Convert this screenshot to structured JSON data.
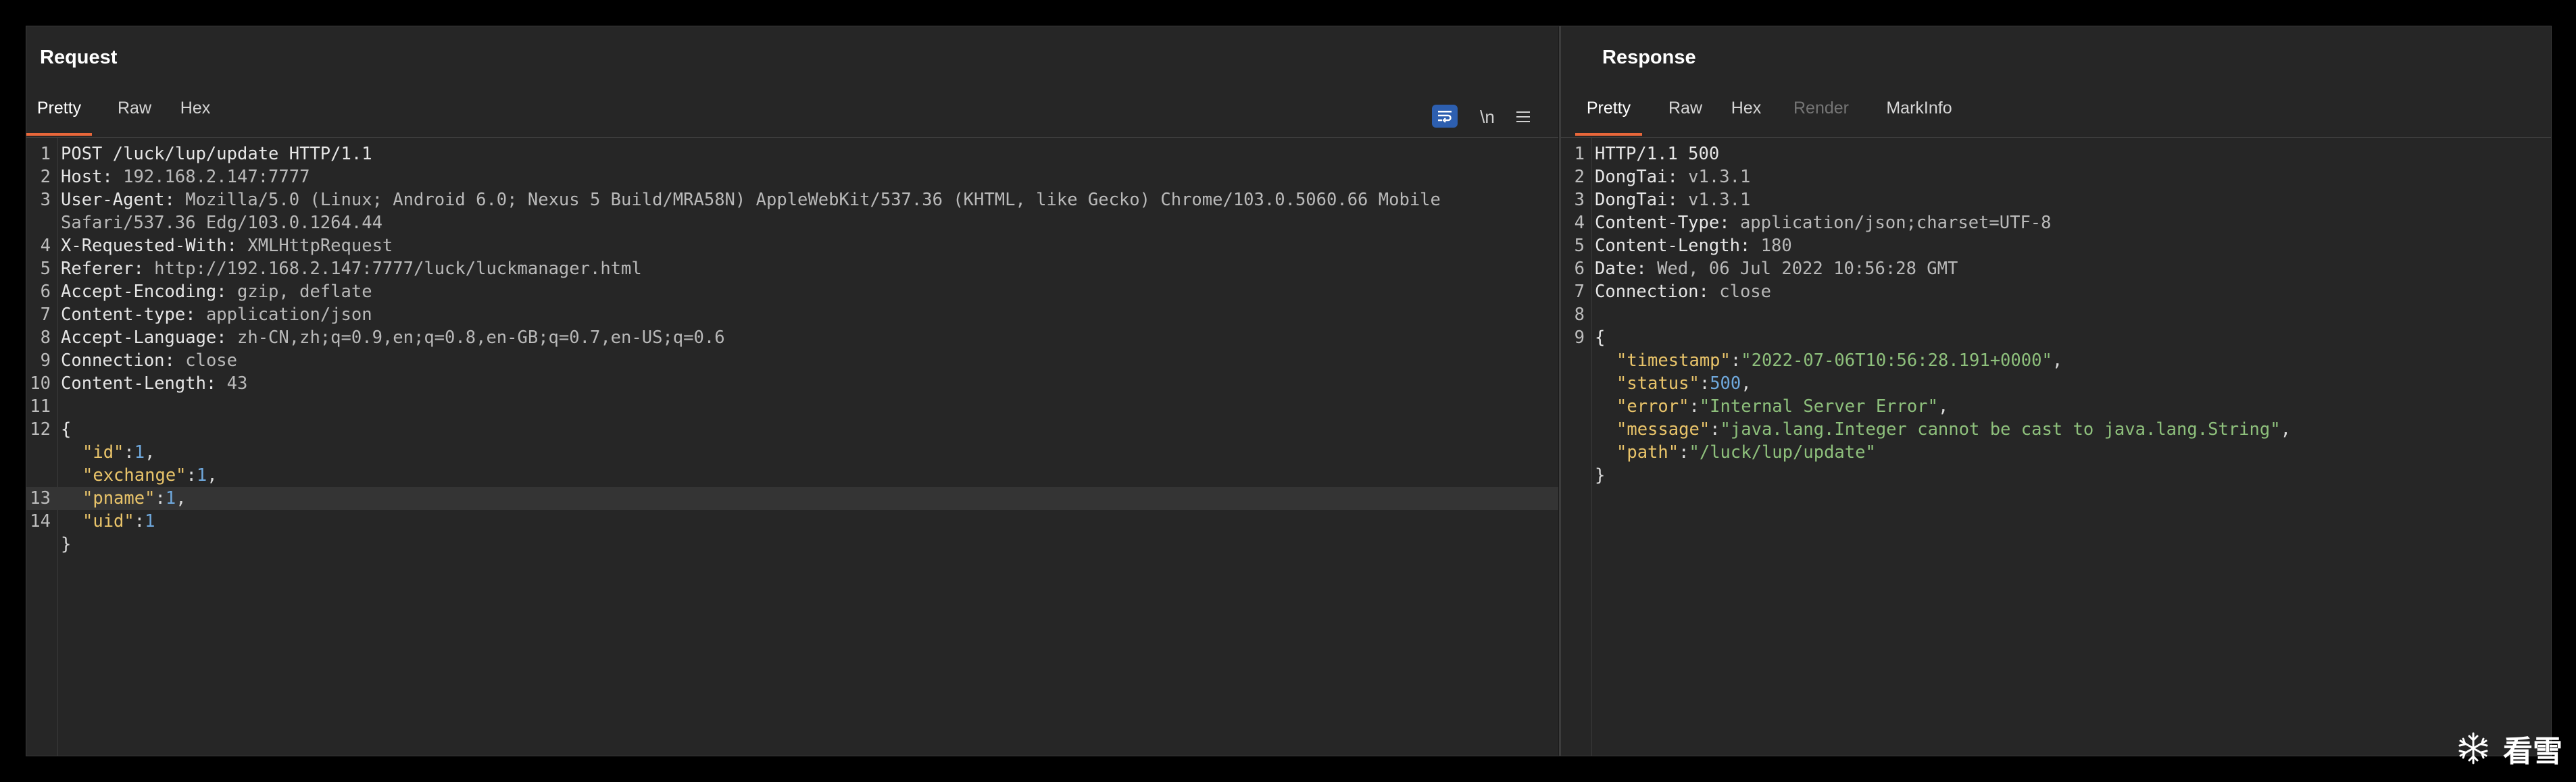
{
  "request": {
    "title": "Request",
    "tabs": [
      "Pretty",
      "Raw",
      "Hex"
    ],
    "active_tab": "Pretty",
    "toolbar": {
      "wrap_icon": "word-wrap-icon",
      "newline_label": "\\n",
      "menu_icon": "menu-icon"
    },
    "lines": [
      {
        "n": "1",
        "key": "POST /luck/lup/update HTTP/1.1",
        "val": ""
      },
      {
        "n": "2",
        "key": "Host:",
        "val": " 192.168.2.147:7777"
      },
      {
        "n": "3",
        "key": "User-Agent:",
        "val": " Mozilla/5.0 (Linux; Android 6.0; Nexus 5 Build/MRA58N) AppleWebKit/537.36 (KHTML, like Gecko) Chrome/103.0.5060.66 Mobile"
      },
      {
        "n": "",
        "key": "",
        "val": "Safari/537.36 Edg/103.0.1264.44"
      },
      {
        "n": "4",
        "key": "X-Requested-With:",
        "val": " XMLHttpRequest"
      },
      {
        "n": "5",
        "key": "Referer:",
        "val": " http://192.168.2.147:7777/luck/luckmanager.html"
      },
      {
        "n": "6",
        "key": "Accept-Encoding:",
        "val": " gzip, deflate"
      },
      {
        "n": "7",
        "key": "Content-type:",
        "val": " application/json"
      },
      {
        "n": "8",
        "key": "Accept-Language:",
        "val": " zh-CN,zh;q=0.9,en;q=0.8,en-GB;q=0.7,en-US;q=0.6"
      },
      {
        "n": "9",
        "key": "Connection:",
        "val": " close"
      },
      {
        "n": "10",
        "key": "Content-Length:",
        "val": " 43"
      },
      {
        "n": "11",
        "key": "",
        "val": ""
      },
      {
        "n": "12",
        "key": "{",
        "val": ""
      }
    ],
    "json_lines": [
      {
        "n": "",
        "key": "\"id\"",
        "sep": ":",
        "val": "1",
        "type": "num",
        "tail": ","
      },
      {
        "n": "",
        "key": "\"exchange\"",
        "sep": ":",
        "val": "1",
        "type": "num",
        "tail": ","
      },
      {
        "n": "13",
        "key": "\"pname\"",
        "sep": ":",
        "val": "1",
        "type": "num",
        "tail": ",",
        "highlight": true
      },
      {
        "n": "14",
        "key": "\"uid\"",
        "sep": ":",
        "val": "1",
        "type": "num",
        "tail": ""
      }
    ],
    "closing_brace": "}"
  },
  "response": {
    "title": "Response",
    "tabs": [
      "Pretty",
      "Raw",
      "Hex",
      "Render",
      "MarkInfo"
    ],
    "active_tab": "Pretty",
    "disabled_tab": "Render",
    "lines": [
      {
        "n": "1",
        "key": "HTTP/1.1 500",
        "val": ""
      },
      {
        "n": "2",
        "key": "DongTai:",
        "val": " v1.3.1"
      },
      {
        "n": "3",
        "key": "DongTai:",
        "val": " v1.3.1"
      },
      {
        "n": "4",
        "key": "Content-Type:",
        "val": " application/json;charset=UTF-8"
      },
      {
        "n": "5",
        "key": "Content-Length:",
        "val": " 180"
      },
      {
        "n": "6",
        "key": "Date:",
        "val": " Wed, 06 Jul 2022 10:56:28 GMT"
      },
      {
        "n": "7",
        "key": "Connection:",
        "val": " close"
      },
      {
        "n": "8",
        "key": "",
        "val": ""
      },
      {
        "n": "9",
        "key": "{",
        "val": ""
      }
    ],
    "json_lines": [
      {
        "n": "",
        "key": "\"timestamp\"",
        "sep": ":",
        "val": "\"2022-07-06T10:56:28.191+0000\"",
        "type": "str",
        "tail": ","
      },
      {
        "n": "",
        "key": "\"status\"",
        "sep": ":",
        "val": "500",
        "type": "num",
        "tail": ","
      },
      {
        "n": "",
        "key": "\"error\"",
        "sep": ":",
        "val": "\"Internal Server Error\"",
        "type": "str",
        "tail": ","
      },
      {
        "n": "",
        "key": "\"message\"",
        "sep": ":",
        "val": "\"java.lang.Integer cannot be cast to java.lang.String\"",
        "type": "str",
        "tail": ","
      },
      {
        "n": "",
        "key": "\"path\"",
        "sep": ":",
        "val": "\"/luck/lup/update\"",
        "type": "str",
        "tail": ""
      }
    ],
    "closing_brace": "}"
  },
  "watermark": {
    "text": "看雪",
    "icon": "snowflake-icon"
  },
  "colors": {
    "accent": "#e8673a",
    "wrap_button": "#2d5fb0",
    "json_key": "#e9c46a",
    "json_string": "#8ec07c",
    "json_number": "#6fa8dc"
  }
}
